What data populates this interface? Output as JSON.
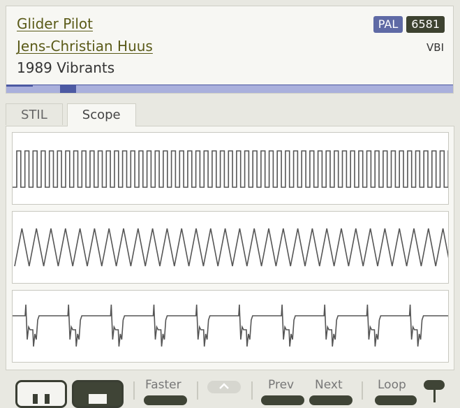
{
  "track": {
    "title": "Glider Pilot",
    "author": "Jens-Christian Huus",
    "released": "1989 Vibrants",
    "badges": {
      "clock": "PAL",
      "chip": "6581"
    },
    "timing": "VBI",
    "progress": 0.06
  },
  "tabs": [
    {
      "label": "STIL",
      "active": false
    },
    {
      "label": "Scope",
      "active": true
    }
  ],
  "scope": {
    "channels": [
      {
        "waveform": "pulse",
        "cycles": 53.5
      },
      {
        "waveform": "triangle",
        "cycles": 30
      },
      {
        "waveform": "pulse-ringing",
        "cycles": 10.2
      }
    ]
  },
  "controls": {
    "faster_label": "Faster",
    "prev_label": "Prev",
    "next_label": "Next",
    "loop_label": "Loop"
  },
  "colors": {
    "link": "#5a5a18",
    "badge_pal": "#5f6aa5",
    "badge_chip": "#3d4230",
    "progress_track": "#aab0dc",
    "progress_fill": "#4d5aa3",
    "waveform": "#555555"
  },
  "icons": {
    "pause_button": "pause-icon",
    "stop_button": "stop-icon",
    "up_button": "chevron-up-icon"
  }
}
